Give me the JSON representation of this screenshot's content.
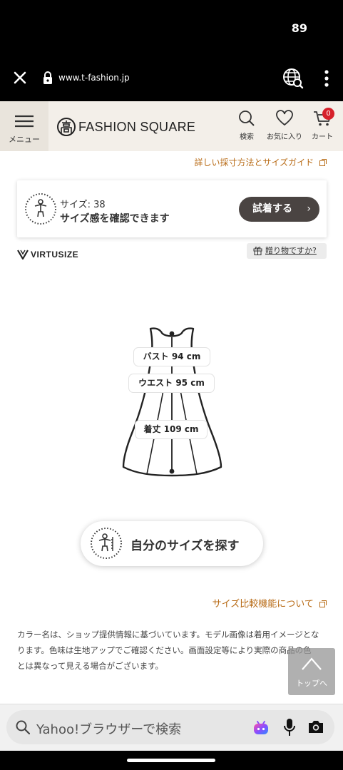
{
  "status_bar": {
    "battery": "89"
  },
  "browser": {
    "url": "www.t-fashion.jp"
  },
  "header": {
    "menu_label": "メニュー",
    "logo_text": "FASHION SQUARE",
    "search_label": "検索",
    "favorites_label": "お気に入り",
    "cart_label": "カート",
    "cart_count": "0"
  },
  "size_guide_link": "詳しい採寸方法とサイズガイド",
  "fit_card": {
    "size_text": "サイズ: 38",
    "message": "サイズ感を確認できます",
    "try_button": "試着する",
    "try_chevron": "›"
  },
  "virtusize_logo": "VIRTUSIZE",
  "gift_link": "贈り物ですか?",
  "measurements": {
    "bust": "バスト 94 cm",
    "waist": "ウエスト 95 cm",
    "length": "着丈 109 cm"
  },
  "find_size_button": "自分のサイズを探す",
  "compare_link": "サイズ比較機能について",
  "color_note": "カラー名は、ショップ提供情報に基づいています。モデル画像は着用イメージとなります。色味は生地アップでご確認ください。画面設定等により実際の商品の色とは異なって見える場合がございます。",
  "top_button": "トップへ",
  "search_bar": {
    "placeholder": "Yahoo!ブラウザーで検索"
  },
  "colors": {
    "link": "#b86b16",
    "button_dark": "#4a4442",
    "badge": "#d6202a",
    "header_bg": "#f3efe9"
  },
  "icons": [
    "close-icon",
    "lock-icon",
    "globe-search-icon",
    "more-vert-icon",
    "hamburger-icon",
    "search-icon",
    "heart-icon",
    "cart-icon",
    "external-link-icon",
    "avatar-icon",
    "gift-icon",
    "arrow-up-icon",
    "mic-icon",
    "camera-icon",
    "ai-assistant-icon"
  ]
}
